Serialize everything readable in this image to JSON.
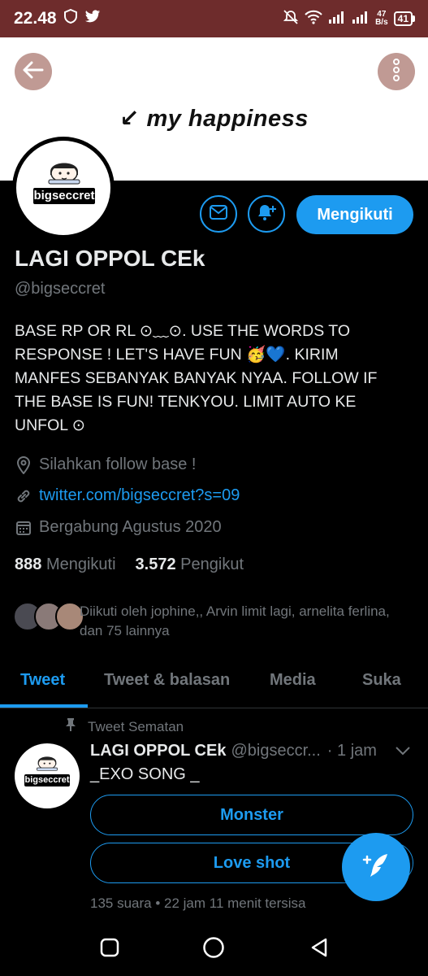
{
  "status_bar": {
    "time": "22.48",
    "net_speed_value": "47",
    "net_speed_unit": "B/s",
    "battery": "41"
  },
  "banner": {
    "text": "↙ my happiness"
  },
  "avatar": {
    "logo_text": "bigseccret"
  },
  "actions": {
    "follow_label": "Mengikuti"
  },
  "profile": {
    "name": "LAGI OPPOL CEk",
    "handle": "@bigseccret",
    "bio": "BASE RP OR RL ⊙﹏⊙. USE THE WORDS TO RESPONSE ! LET'S HAVE FUN 🥳💙. KIRIM MANFES SEBANYAK BANYAK NYAA. FOLLOW IF THE BASE IS FUN! TENKYOU. LIMIT AUTO KE UNFOL ⊙",
    "location": "Silahkan follow base !",
    "link": "twitter.com/bigseccret?s=09",
    "joined": "Bergabung Agustus 2020",
    "following_count": "888",
    "following_label": "Mengikuti",
    "followers_count": "3.572",
    "followers_label": "Pengikut",
    "followed_by": "Diikuti oleh jophine,, Arvin limit lagi, arnelita ferlina, dan 75 lainnya"
  },
  "tabs": [
    {
      "label": "Tweet"
    },
    {
      "label": "Tweet & balasan"
    },
    {
      "label": "Media"
    },
    {
      "label": "Suka"
    }
  ],
  "pinned_tweet": {
    "pinned_label": "Tweet Sematan",
    "author_name": "LAGI OPPOL CEk",
    "author_handle": "@bigseccr...",
    "time": "· 1 jam",
    "text": "_EXO SONG _",
    "avatar_logo_text": "bigseccret",
    "poll_options": [
      {
        "label": "Monster"
      },
      {
        "label": "Love shot"
      }
    ],
    "poll_meta": "135 suara • 22 jam 11 menit tersisa"
  },
  "colors": {
    "accent": "#1d9bf0",
    "status_bar": "#6e2c2c",
    "background": "#000000",
    "muted_text": "#71767b"
  },
  "icons": [
    "shield-icon",
    "twitter-bird-icon",
    "mute-icon",
    "wifi-icon",
    "signal-icon",
    "battery-icon",
    "back-arrow-icon",
    "more-vertical-icon",
    "mail-icon",
    "bell-plus-icon",
    "location-pin-icon",
    "link-icon",
    "calendar-icon",
    "pin-icon",
    "chevron-down-icon",
    "compose-feather-icon",
    "nav-square-icon",
    "nav-circle-icon",
    "nav-back-icon"
  ]
}
